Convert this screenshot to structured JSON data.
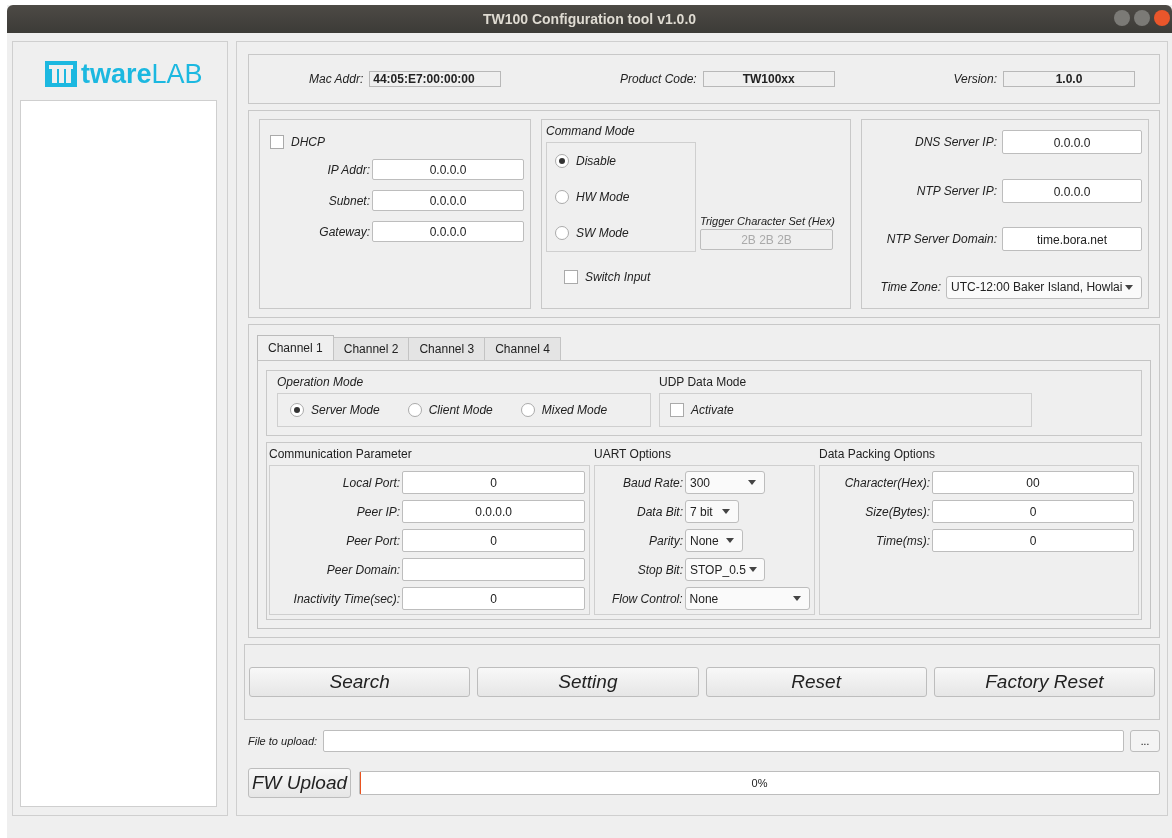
{
  "window": {
    "title": "TW100 Configuration tool v1.0.0"
  },
  "logo": {
    "bold": "tware",
    "light": "LAB"
  },
  "info": [
    {
      "label": "Mac Addr:",
      "value": "44:05:E7:00:00:00"
    },
    {
      "label": "Product Code:",
      "value": "TW100xx"
    },
    {
      "label": "Version:",
      "value": "1.0.0"
    }
  ],
  "network": {
    "dhcp": {
      "label": "DHCP",
      "checked": false
    },
    "fields": [
      {
        "label": "IP Addr:",
        "value": "0.0.0.0"
      },
      {
        "label": "Subnet:",
        "value": "0.0.0.0"
      },
      {
        "label": "Gateway:",
        "value": "0.0.0.0"
      }
    ]
  },
  "command_mode": {
    "title": "Command Mode",
    "options": [
      {
        "label": "Disable",
        "selected": true
      },
      {
        "label": "HW Mode",
        "selected": false
      },
      {
        "label": "SW Mode",
        "selected": false
      }
    ],
    "trigger": {
      "label": "Trigger Character Set (Hex)",
      "value": "2B 2B 2B",
      "disabled": true
    },
    "switch_input": {
      "label": "Switch Input",
      "checked": false
    }
  },
  "servers": {
    "fields": [
      {
        "label": "DNS Server IP:",
        "value": "0.0.0.0"
      },
      {
        "label": "NTP Server IP:",
        "value": "0.0.0.0"
      },
      {
        "label": "NTP Server Domain:",
        "value": "time.bora.net"
      }
    ],
    "time_zone": {
      "label": "Time Zone:",
      "value": "UTC-12:00 Baker Island, Howlai"
    }
  },
  "tabs": [
    {
      "label": "Channel 1",
      "selected": true
    },
    {
      "label": "Channel 2",
      "selected": false
    },
    {
      "label": "Channel 3",
      "selected": false
    },
    {
      "label": "Channel 4",
      "selected": false
    }
  ],
  "operation_mode": {
    "title": "Operation Mode",
    "options": [
      {
        "label": "Server Mode",
        "selected": true
      },
      {
        "label": "Client Mode",
        "selected": false
      },
      {
        "label": "Mixed Mode",
        "selected": false
      }
    ]
  },
  "udp_data_mode": {
    "title": "UDP Data Mode",
    "activate": {
      "label": "Activate",
      "checked": false
    }
  },
  "communication": {
    "title": "Communication Parameter",
    "fields": [
      {
        "label": "Local Port:",
        "value": "0"
      },
      {
        "label": "Peer IP:",
        "value": "0.0.0.0"
      },
      {
        "label": "Peer Port:",
        "value": "0"
      },
      {
        "label": "Peer Domain:"
      },
      {
        "label": "Inactivity Time(sec):",
        "value": "0"
      }
    ]
  },
  "uart": {
    "title": "UART Options",
    "fields": [
      {
        "label": "Baud Rate:",
        "value": "300"
      },
      {
        "label": "Data Bit:",
        "value": "7 bit"
      },
      {
        "label": "Parity:",
        "value": "None"
      },
      {
        "label": "Stop Bit:",
        "value": "STOP_0.5"
      },
      {
        "label": "Flow Control:",
        "value": "None"
      }
    ]
  },
  "packing": {
    "title": "Data Packing Options",
    "fields": [
      {
        "label": "Character(Hex):",
        "value": "00"
      },
      {
        "label": "Size(Bytes):",
        "value": "0"
      },
      {
        "label": "Time(ms):",
        "value": "0"
      }
    ]
  },
  "buttons": [
    "Search",
    "Setting",
    "Reset",
    "Factory Reset"
  ],
  "upload": {
    "label": "File to upload:",
    "browse": "...",
    "button": "FW Upload",
    "progress": {
      "level": 0,
      "text": "0%"
    }
  }
}
